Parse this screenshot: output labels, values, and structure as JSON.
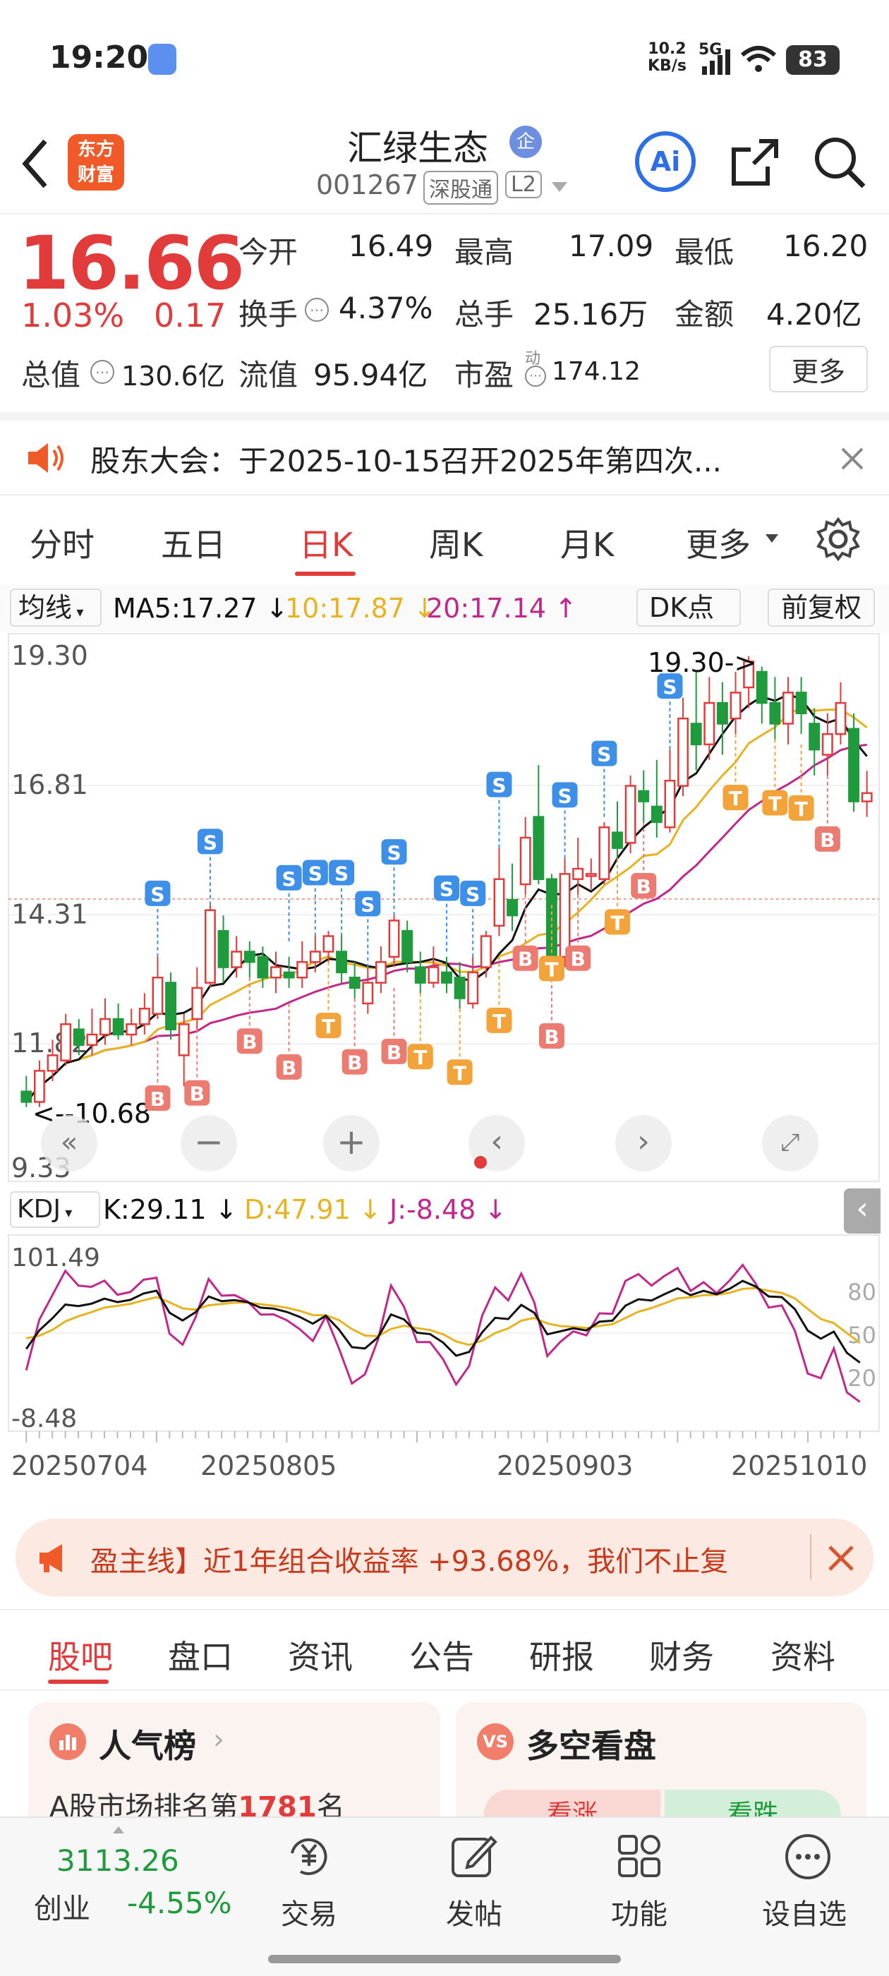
{
  "status_bar": {
    "time": "19:20",
    "net_speed_top": "10.2",
    "net_speed_bottom": "KB/s",
    "network": "5G",
    "battery": "83"
  },
  "header": {
    "logo_line1": "东方",
    "logo_line2": "财富",
    "title": "汇绿生态",
    "enterprise_badge": "企",
    "code": "001267",
    "tag1": "深股通",
    "tag2": "L2",
    "ai_label": "Ai"
  },
  "quote": {
    "price": "16.66",
    "change_pct": "1.03%",
    "change": "0.17",
    "open_label": "今开",
    "open": "16.49",
    "high_label": "最高",
    "high": "17.09",
    "low_label": "最低",
    "low": "16.20",
    "turnover_label": "换手",
    "turnover": "4.37%",
    "volume_label": "总手",
    "volume": "25.16万",
    "amount_label": "金额",
    "amount": "4.20亿",
    "mcap_label": "总值",
    "mcap": "130.6亿",
    "float_label": "流值",
    "float": "95.94亿",
    "pe_label": "市盈",
    "pe_sup": "动",
    "pe": "174.12",
    "more_label": "更多"
  },
  "notice": {
    "text": "股东大会：于2025-10-15召开2025年第四次..."
  },
  "chart_tabs": [
    {
      "label": "分时",
      "active": false
    },
    {
      "label": "五日",
      "active": false
    },
    {
      "label": "日K",
      "active": true
    },
    {
      "label": "周K",
      "active": false
    },
    {
      "label": "月K",
      "active": false
    },
    {
      "label": "更多",
      "active": false
    }
  ],
  "ma_legend": {
    "selector": "均线",
    "ma5": "MA5:17.27 ↓",
    "ma10": "10:17.87 ↓",
    "ma20": "20:17.14 ↑",
    "dk": "DK点",
    "adjust": "前复权"
  },
  "kdj_legend": {
    "selector": "KDJ",
    "k": "K:29.11 ↓",
    "d": "D:47.91 ↓",
    "j": "J:-8.48 ↓"
  },
  "colors": {
    "up": "#e23b3b",
    "down": "#1f9a3c",
    "ma5": "#111111",
    "ma10": "#e6b422",
    "ma20": "#c0288c",
    "s_marker": "#3d8fe8",
    "b_marker": "#ec7b72",
    "t_marker": "#f2a33a"
  },
  "chart_data": {
    "type": "candlestick",
    "y_ticks": [
      "19.30",
      "16.81",
      "14.31",
      "11.82",
      "9.33"
    ],
    "annotations": [
      "19.30->",
      "<--10.68"
    ],
    "x_ticks": [
      "20250704",
      "20250805",
      "20250903",
      "20251010"
    ],
    "kdj_y_ticks": [
      "101.49",
      "-8.48"
    ],
    "kdj_right_ticks": [
      "80",
      "50",
      "20"
    ],
    "candles": [
      {
        "o": 10.9,
        "c": 10.7,
        "h": 11.2,
        "l": 10.6
      },
      {
        "o": 10.7,
        "c": 11.3,
        "h": 11.5,
        "l": 10.6
      },
      {
        "o": 11.3,
        "c": 11.6,
        "h": 11.9,
        "l": 11.1
      },
      {
        "o": 11.5,
        "c": 12.2,
        "h": 12.4,
        "l": 11.4
      },
      {
        "o": 12.1,
        "c": 11.8,
        "h": 12.3,
        "l": 11.6
      },
      {
        "o": 11.8,
        "c": 12.0,
        "h": 12.5,
        "l": 11.6
      },
      {
        "o": 12.0,
        "c": 12.3,
        "h": 12.7,
        "l": 11.8
      },
      {
        "o": 12.3,
        "c": 12.0,
        "h": 12.6,
        "l": 11.9
      },
      {
        "o": 12.0,
        "c": 12.2,
        "h": 12.5,
        "l": 11.8
      },
      {
        "o": 12.2,
        "c": 12.5,
        "h": 12.8,
        "l": 12.0
      },
      {
        "o": 12.4,
        "c": 13.1,
        "h": 13.5,
        "l": 12.3
      },
      {
        "o": 13.0,
        "c": 12.1,
        "h": 13.2,
        "l": 11.9
      },
      {
        "o": 11.6,
        "c": 12.2,
        "h": 12.4,
        "l": 11.0
      },
      {
        "o": 12.3,
        "c": 12.9,
        "h": 13.3,
        "l": 12.1
      },
      {
        "o": 13.0,
        "c": 14.4,
        "h": 14.5,
        "l": 12.9
      },
      {
        "o": 14.0,
        "c": 13.3,
        "h": 14.3,
        "l": 13.0
      },
      {
        "o": 13.3,
        "c": 13.6,
        "h": 13.9,
        "l": 13.1
      },
      {
        "o": 13.6,
        "c": 13.4,
        "h": 13.8,
        "l": 13.1
      },
      {
        "o": 13.5,
        "c": 13.1,
        "h": 13.7,
        "l": 12.9
      },
      {
        "o": 13.1,
        "c": 13.3,
        "h": 13.6,
        "l": 12.8
      },
      {
        "o": 13.2,
        "c": 13.1,
        "h": 13.5,
        "l": 12.9
      },
      {
        "o": 13.1,
        "c": 13.4,
        "h": 13.8,
        "l": 12.9
      },
      {
        "o": 13.4,
        "c": 13.6,
        "h": 13.9,
        "l": 13.2
      },
      {
        "o": 13.6,
        "c": 13.9,
        "h": 14.0,
        "l": 13.4
      },
      {
        "o": 13.6,
        "c": 13.2,
        "h": 13.9,
        "l": 13.0
      },
      {
        "o": 13.1,
        "c": 12.9,
        "h": 13.4,
        "l": 12.7
      },
      {
        "o": 12.6,
        "c": 13.0,
        "h": 13.3,
        "l": 12.4
      },
      {
        "o": 13.0,
        "c": 13.4,
        "h": 13.7,
        "l": 12.8
      },
      {
        "o": 13.5,
        "c": 14.2,
        "h": 14.3,
        "l": 13.3
      },
      {
        "o": 14.0,
        "c": 13.4,
        "h": 14.2,
        "l": 13.2
      },
      {
        "o": 13.3,
        "c": 13.0,
        "h": 13.6,
        "l": 12.8
      },
      {
        "o": 13.0,
        "c": 13.3,
        "h": 13.7,
        "l": 12.9
      },
      {
        "o": 13.2,
        "c": 13.0,
        "h": 13.5,
        "l": 12.8
      },
      {
        "o": 13.1,
        "c": 12.7,
        "h": 13.4,
        "l": 12.5
      },
      {
        "o": 12.6,
        "c": 13.2,
        "h": 13.5,
        "l": 12.5
      },
      {
        "o": 13.3,
        "c": 13.9,
        "h": 14.0,
        "l": 13.1
      },
      {
        "o": 14.1,
        "c": 15.0,
        "h": 15.6,
        "l": 13.9
      },
      {
        "o": 14.6,
        "c": 14.3,
        "h": 15.3,
        "l": 14.0
      },
      {
        "o": 14.9,
        "c": 15.8,
        "h": 16.2,
        "l": 14.7
      },
      {
        "o": 16.2,
        "c": 15.0,
        "h": 17.2,
        "l": 14.9
      },
      {
        "o": 15.0,
        "c": 13.4,
        "h": 15.1,
        "l": 13.2
      },
      {
        "o": 13.5,
        "c": 15.1,
        "h": 15.4,
        "l": 13.3
      },
      {
        "o": 15.0,
        "c": 15.2,
        "h": 15.8,
        "l": 14.7
      },
      {
        "o": 15.1,
        "c": 15.1,
        "h": 15.4,
        "l": 14.8
      },
      {
        "o": 15.0,
        "c": 16.0,
        "h": 16.1,
        "l": 14.9
      },
      {
        "o": 15.9,
        "c": 15.6,
        "h": 16.5,
        "l": 15.4
      },
      {
        "o": 15.7,
        "c": 16.8,
        "h": 17.0,
        "l": 15.5
      },
      {
        "o": 16.7,
        "c": 16.5,
        "h": 17.1,
        "l": 16.1
      },
      {
        "o": 16.4,
        "c": 16.1,
        "h": 17.3,
        "l": 15.8
      },
      {
        "o": 16.0,
        "c": 16.9,
        "h": 17.5,
        "l": 15.9
      },
      {
        "o": 16.8,
        "c": 18.1,
        "h": 18.5,
        "l": 16.6
      },
      {
        "o": 18.0,
        "c": 17.6,
        "h": 19.0,
        "l": 17.1
      },
      {
        "o": 17.6,
        "c": 18.4,
        "h": 18.9,
        "l": 17.3
      },
      {
        "o": 18.4,
        "c": 18.0,
        "h": 18.8,
        "l": 17.4
      },
      {
        "o": 18.1,
        "c": 18.6,
        "h": 19.0,
        "l": 17.8
      },
      {
        "o": 18.7,
        "c": 19.2,
        "h": 19.3,
        "l": 18.3
      },
      {
        "o": 19.0,
        "c": 18.4,
        "h": 19.1,
        "l": 18.0
      },
      {
        "o": 18.4,
        "c": 18.0,
        "h": 18.9,
        "l": 17.7
      },
      {
        "o": 18.0,
        "c": 18.6,
        "h": 18.9,
        "l": 17.6
      },
      {
        "o": 18.6,
        "c": 18.2,
        "h": 18.9,
        "l": 17.8
      },
      {
        "o": 18.0,
        "c": 17.5,
        "h": 18.3,
        "l": 17.0
      },
      {
        "o": 17.4,
        "c": 17.8,
        "h": 18.2,
        "l": 17.0
      },
      {
        "o": 17.8,
        "c": 18.4,
        "h": 18.8,
        "l": 17.6
      },
      {
        "o": 17.9,
        "c": 16.5,
        "h": 18.2,
        "l": 16.3
      },
      {
        "o": 16.5,
        "c": 16.66,
        "h": 17.09,
        "l": 16.2
      }
    ]
  },
  "banner": {
    "text": "盈主线】近1年组合收益率 +93.68%，我们不止复"
  },
  "bottom_tabs": [
    {
      "label": "股吧",
      "active": true
    },
    {
      "label": "盘口",
      "active": false
    },
    {
      "label": "资讯",
      "active": false
    },
    {
      "label": "公告",
      "active": false
    },
    {
      "label": "研报",
      "active": false
    },
    {
      "label": "财务",
      "active": false
    },
    {
      "label": "资料",
      "active": false
    }
  ],
  "cards": {
    "popularity_title": "人气榜",
    "popularity_text_pre": "A股市场排名第",
    "popularity_rank": "1781",
    "popularity_text_post": "名",
    "duokong_title": "多空看盘",
    "bull": "看涨",
    "bear": "看跌"
  },
  "bottom_nav": {
    "index_value": "3113.26",
    "index_name": "创业",
    "index_change": "-4.55%",
    "items": [
      "交易",
      "发帖",
      "功能",
      "设自选"
    ]
  }
}
